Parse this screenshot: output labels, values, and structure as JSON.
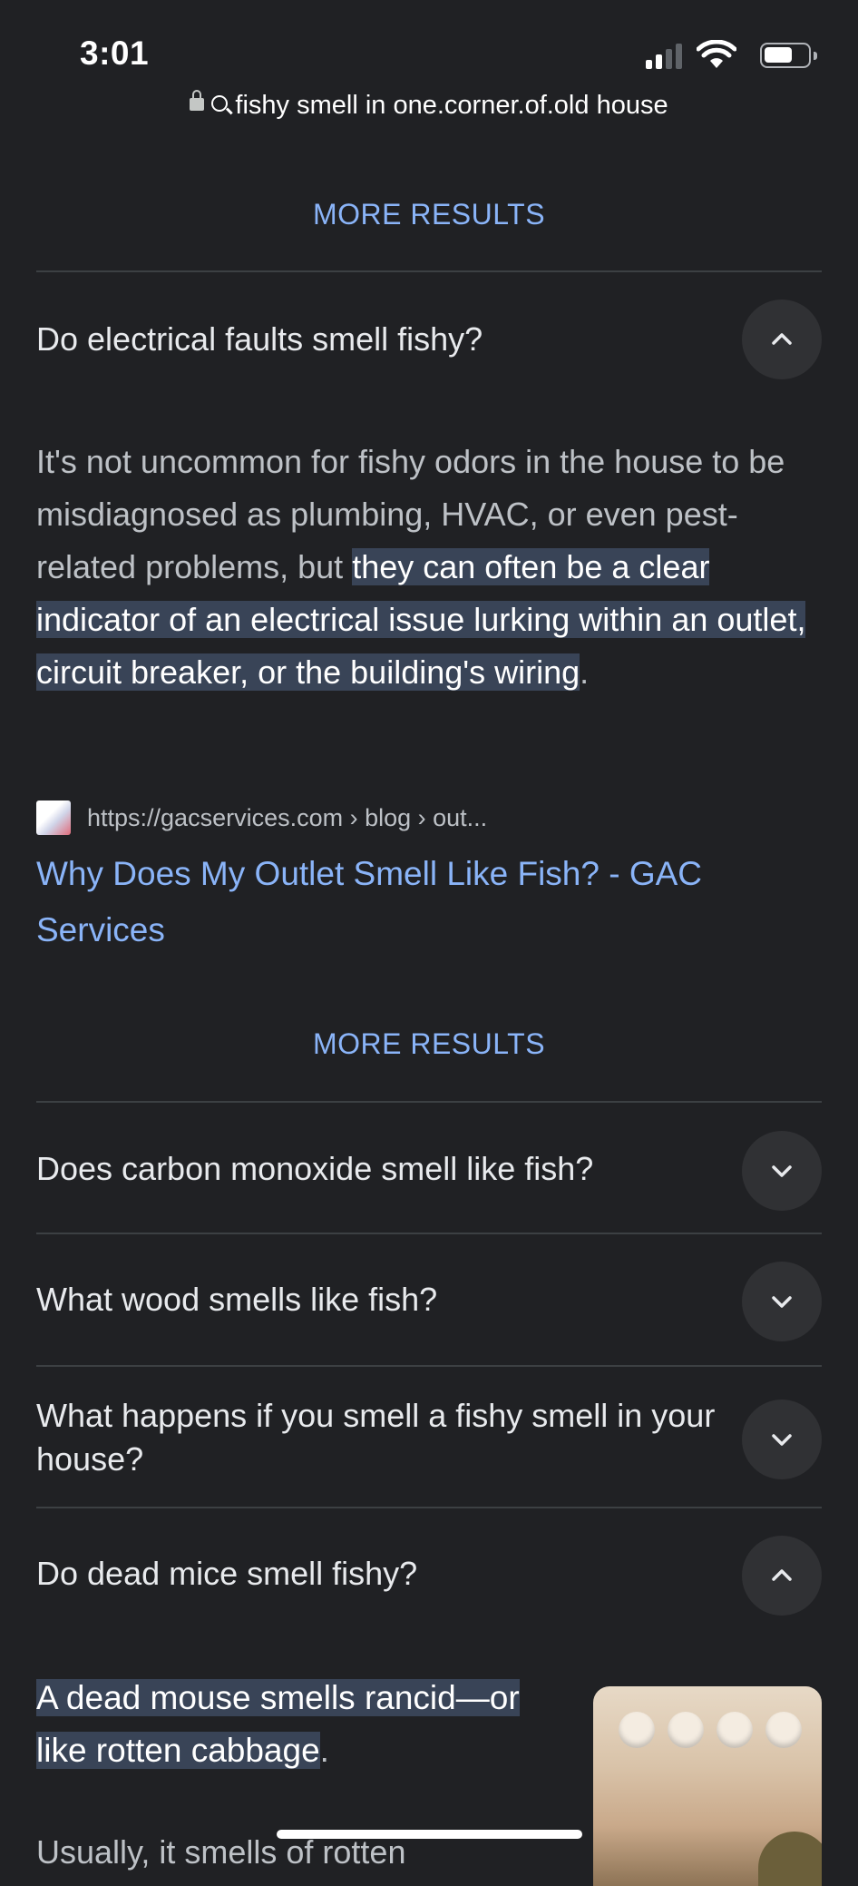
{
  "status_bar": {
    "time": "3:01"
  },
  "url_bar": {
    "query": "fishy smell in one.corner.of.old house"
  },
  "more_results_label": "MORE RESULTS",
  "questions": [
    {
      "text": "Do electrical faults smell fishy?",
      "expanded": true
    },
    {
      "text": "Does carbon monoxide smell like fish?",
      "expanded": false
    },
    {
      "text": "What wood smells like fish?",
      "expanded": false
    },
    {
      "text": "What happens if you smell a fishy smell in your house?",
      "expanded": false
    },
    {
      "text": "Do dead mice smell fishy?",
      "expanded": true
    }
  ],
  "answer1": {
    "plain": "It's not uncommon for fishy odors in the house to be misdiagnosed as plumbing, HVAC, or even pest-related problems, but ",
    "highlight": "they can often be a clear indicator of an electrical issue lurking within an outlet, circuit breaker, or the building's wiring",
    "tail": ".",
    "source_url": "https://gacservices.com › blog › out...",
    "source_title": "Why Does My Outlet Smell Like Fish? - GAC Services"
  },
  "answer2": {
    "highlight": "A dead mouse smells rancid—or like rotten cabbage",
    "tail": ".",
    "next_line": "Usually, it smells of rotten"
  }
}
